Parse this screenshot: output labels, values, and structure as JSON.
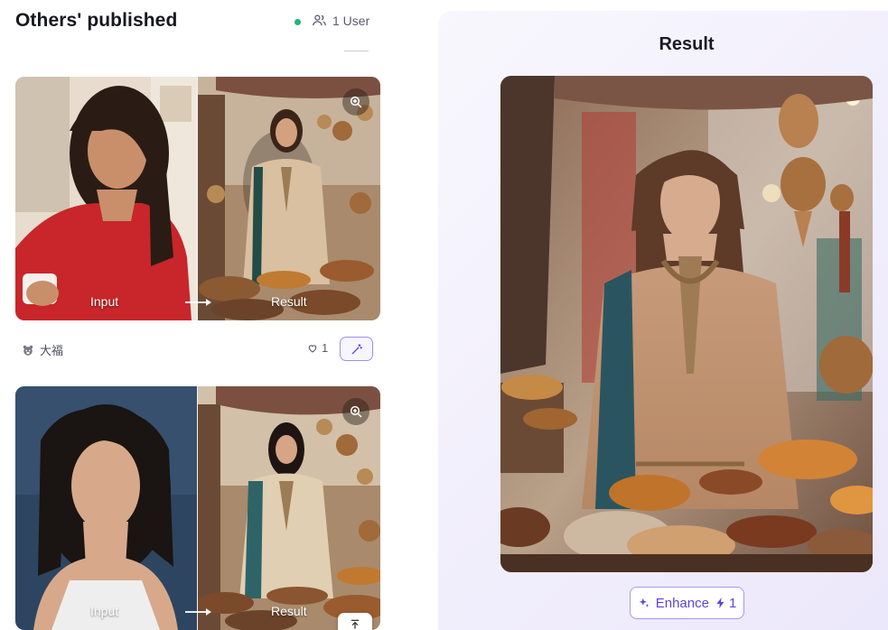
{
  "left_panel": {
    "title": "Others' published",
    "users_label": "1 User",
    "cards": [
      {
        "input_label": "Input",
        "result_label": "Result",
        "author": "大福",
        "likes": "1"
      },
      {
        "input_label": "Input",
        "result_label": "Result"
      }
    ]
  },
  "right_panel": {
    "title": "Result",
    "enhance_label": "Enhance",
    "enhance_cost": "1"
  },
  "icons": {
    "users": "users-icon",
    "zoom": "zoom-in-icon",
    "heart": "heart-icon",
    "wand": "magic-wand-icon",
    "sparkle": "sparkle-icon",
    "bolt": "bolt-icon",
    "scroll_top": "scroll-top-icon"
  },
  "colors": {
    "accent": "#5b45d9",
    "accent_border": "#a996f1",
    "online": "#22b573"
  }
}
